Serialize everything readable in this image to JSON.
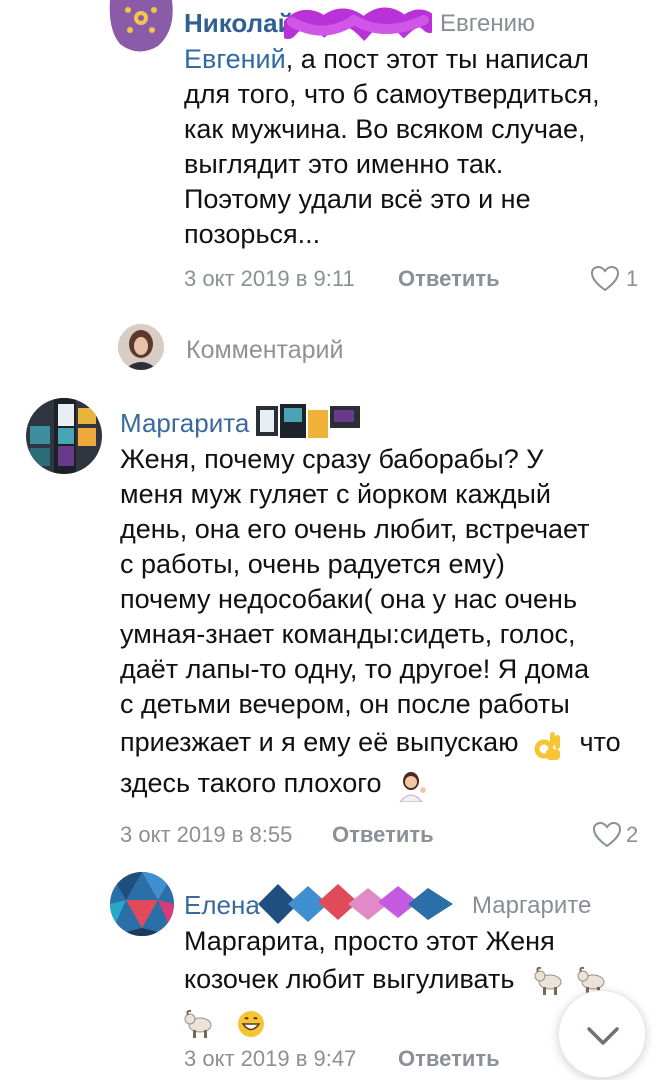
{
  "comment1": {
    "author": "Николай",
    "reply_to": "Евгению",
    "mention": "Евгений",
    "lines": [
      ", а пост этот ты написал",
      "для того, что б самоутвердиться,",
      "как мужчина. Во всяком случае,",
      "выглядит это именно так.",
      "Поэтому удали всё это и не",
      "позорься..."
    ],
    "date": "3 окт 2019 в 9:11",
    "reply_label": "Ответить",
    "likes": "1"
  },
  "composer": {
    "placeholder": "Комментарий"
  },
  "comment2": {
    "author": "Маргарита",
    "lines": [
      "Женя, почему сразу баборабы? У",
      "меня муж гуляет с йорком каждый",
      "день, она его очень любит, встречает",
      "с работы, очень радуется ему)",
      "почему недособаки( она у нас очень",
      "умная-знает команды:сидеть, голос,",
      "даёт лапы-то одну, то другое! Я дома",
      "с детьми вечером, он после работы",
      "приезжает и я ему её выпускаю",
      "что",
      "здесь такого плохого"
    ],
    "date": "3 окт 2019 в 8:55",
    "reply_label": "Ответить",
    "likes": "2"
  },
  "comment3": {
    "author": "Елена",
    "reply_to": "Маргарите",
    "mention": "Маргарита",
    "lines": [
      ", просто этот Женя",
      "козочек любит выгуливать"
    ],
    "date": "3 окт 2019 в 9:47",
    "reply_label": "Ответить"
  },
  "icons": {
    "heart": "heart-icon",
    "scroll_down": "chevron-down-icon",
    "ok_hand": "ok-hand-emoji",
    "shrug": "person-tipping-hand-emoji",
    "goat": "goat-emoji",
    "grin": "grinning-emoji"
  },
  "colors": {
    "link": "#2f5f94",
    "meta": "#8b9096",
    "scribble": "#b832d8"
  }
}
